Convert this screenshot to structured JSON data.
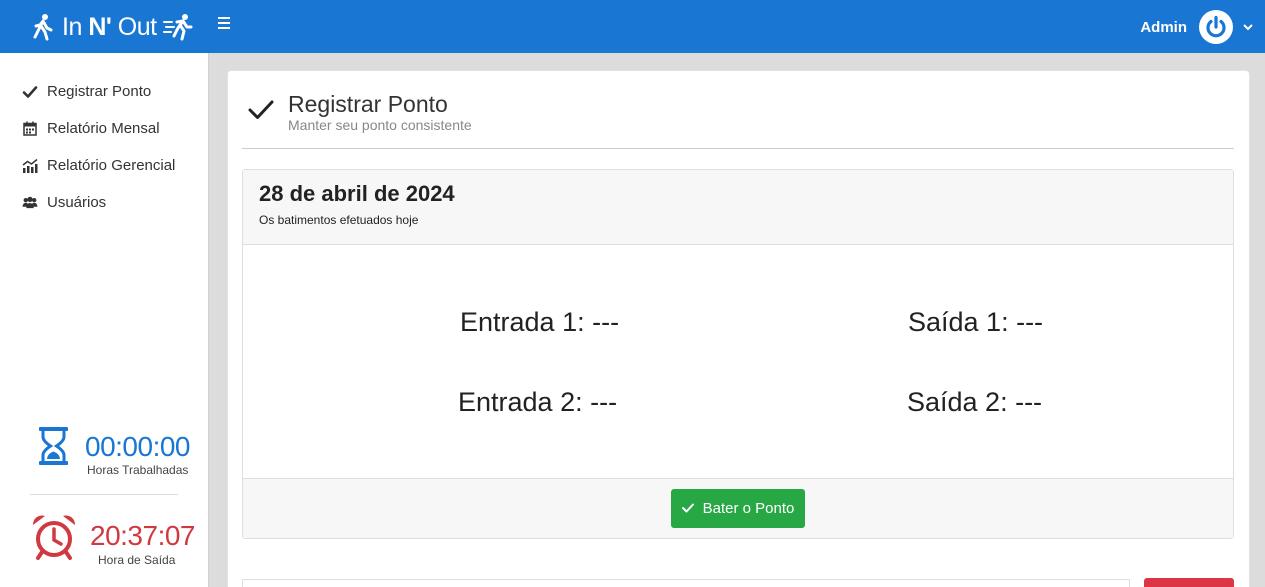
{
  "header": {
    "brand_prefix": "In",
    "brand_bold": "N'",
    "brand_suffix": "Out",
    "user_name": "Admin"
  },
  "sidebar": {
    "items": [
      {
        "label": "Registrar Ponto",
        "icon": "check-icon"
      },
      {
        "label": "Relatório Mensal",
        "icon": "calendar-icon"
      },
      {
        "label": "Relatório Gerencial",
        "icon": "chart-icon"
      },
      {
        "label": "Usuários",
        "icon": "users-icon"
      }
    ],
    "worked": {
      "value": "00:00:00",
      "label": "Horas Trabalhadas",
      "icon": "hourglass-icon",
      "color": "#1976d2"
    },
    "exit": {
      "value": "20:37:07",
      "label": "Hora de Saída",
      "icon": "alarm-clock-icon",
      "color": "#d0393f"
    }
  },
  "page": {
    "title": "Registrar Ponto",
    "subtitle": "Manter seu ponto consistente"
  },
  "panel": {
    "date": "28 de abril de 2024",
    "caption": "Os batimentos efetuados hoje",
    "entrada1": "Entrada 1: ---",
    "saida1": "Saída 1: ---",
    "entrada2": "Entrada 2: ---",
    "saida2": "Saída 2: ---",
    "button_label": "Bater o Ponto"
  },
  "colors": {
    "primary": "#1976d2",
    "success": "#28a745",
    "danger": "#dc3545"
  }
}
